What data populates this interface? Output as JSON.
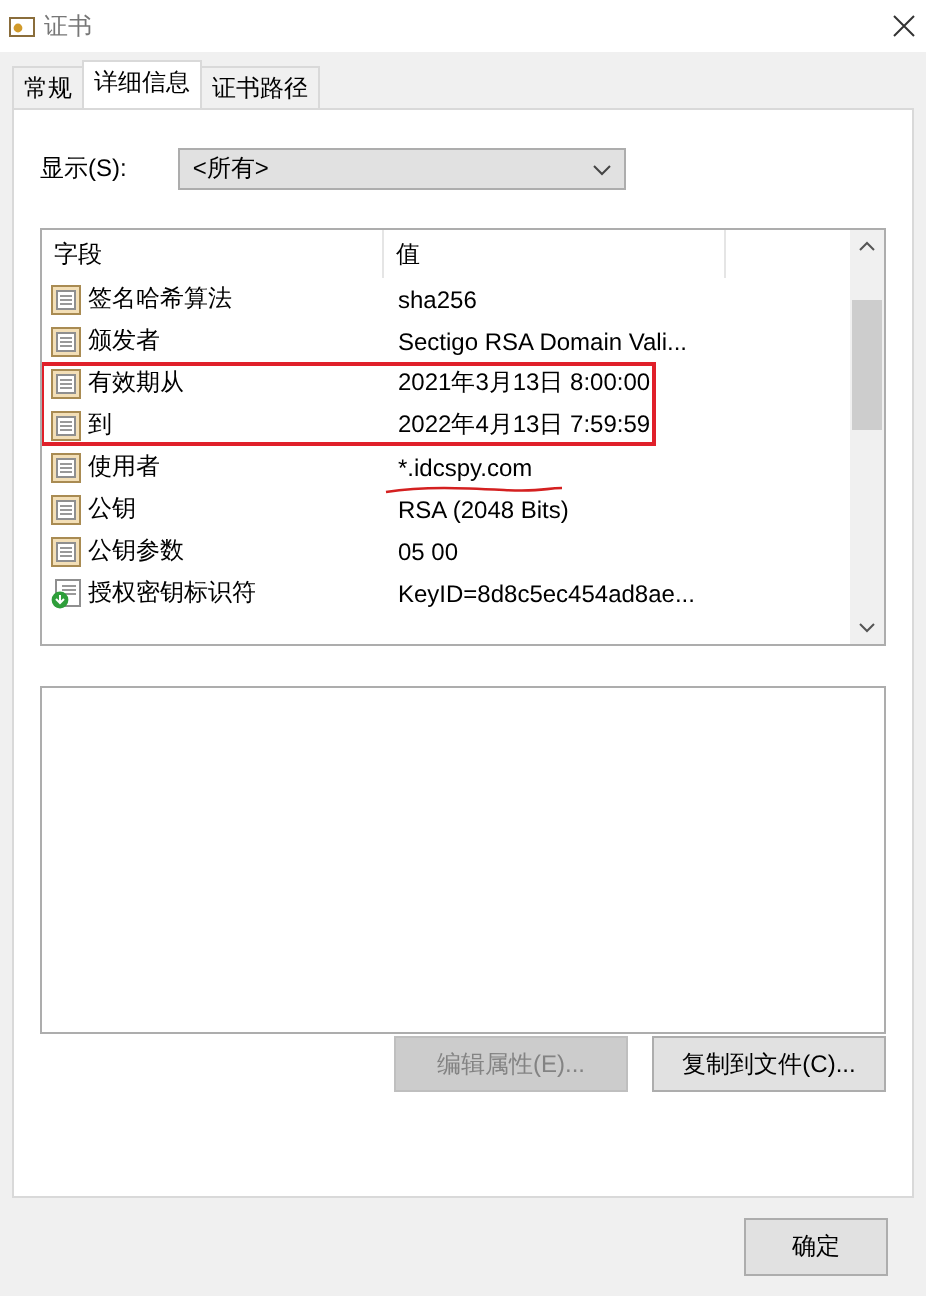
{
  "window": {
    "title": "证书"
  },
  "tabs": [
    {
      "label": "常规",
      "selected": false
    },
    {
      "label": "详细信息",
      "selected": true
    },
    {
      "label": "证书路径",
      "selected": false
    }
  ],
  "show": {
    "label": "显示(S):",
    "value": "<所有>"
  },
  "table": {
    "columns": [
      "字段",
      "值"
    ],
    "rows": [
      {
        "kind": "field",
        "field": "签名哈希算法",
        "value": "sha256",
        "highlighted": false,
        "underlined": false
      },
      {
        "kind": "field",
        "field": "颁发者",
        "value": "Sectigo RSA Domain Vali...",
        "highlighted": false,
        "underlined": false
      },
      {
        "kind": "field",
        "field": "有效期从",
        "value": "2021年3月13日 8:00:00",
        "highlighted": true,
        "underlined": false
      },
      {
        "kind": "field",
        "field": "到",
        "value": "2022年4月13日 7:59:59",
        "highlighted": true,
        "underlined": false
      },
      {
        "kind": "field",
        "field": "使用者",
        "value": "*.idcspy.com",
        "highlighted": false,
        "underlined": true
      },
      {
        "kind": "field",
        "field": "公钥",
        "value": "RSA (2048 Bits)",
        "highlighted": false,
        "underlined": false
      },
      {
        "kind": "field",
        "field": "公钥参数",
        "value": "05 00",
        "highlighted": false,
        "underlined": false
      },
      {
        "kind": "extension",
        "field": "授权密钥标识符",
        "value": "KeyID=8d8c5ec454ad8ae...",
        "highlighted": false,
        "underlined": false
      }
    ]
  },
  "buttons": [
    {
      "label": "编辑属性(E)...",
      "disabled": true
    },
    {
      "label": "复制到文件(C)...",
      "disabled": false
    }
  ],
  "ok_button": {
    "label": "确定"
  }
}
